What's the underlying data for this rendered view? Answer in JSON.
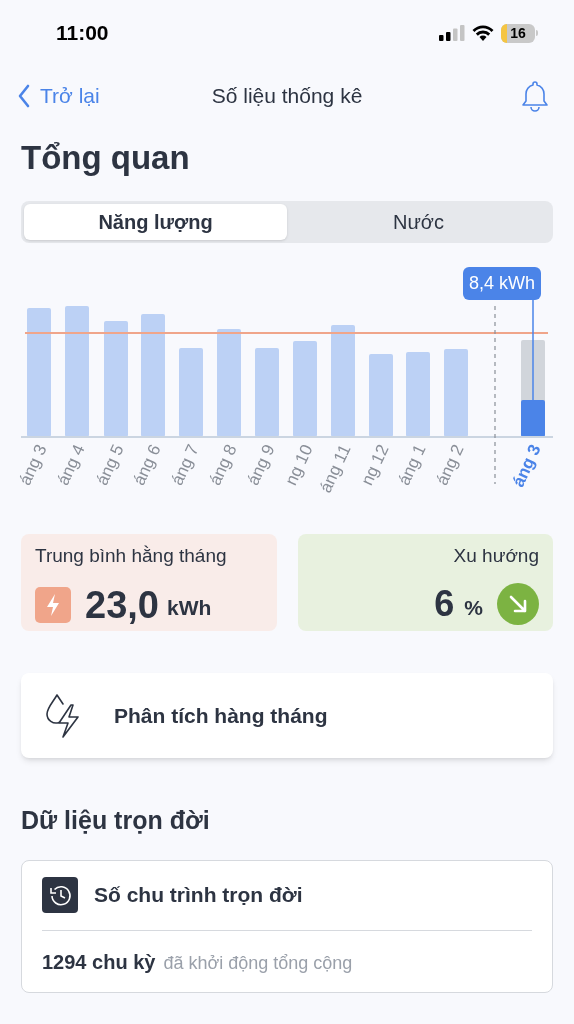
{
  "status_bar": {
    "time": "11:00",
    "battery": "16"
  },
  "nav": {
    "back": "Trở lại",
    "title": "Số liệu thống kê"
  },
  "heading": "Tổng quan",
  "tabs": [
    {
      "label": "Năng lượng",
      "selected": true
    },
    {
      "label": "Nước",
      "selected": false
    }
  ],
  "chart": {
    "tooltip": "8,4 kWh",
    "months": [
      {
        "label": "áng 3",
        "selected": false
      },
      {
        "label": "áng 4",
        "selected": false
      },
      {
        "label": "áng 5",
        "selected": false
      },
      {
        "label": "áng 6",
        "selected": false
      },
      {
        "label": "áng 7",
        "selected": false
      },
      {
        "label": "áng 8",
        "selected": false
      },
      {
        "label": "áng 9",
        "selected": false
      },
      {
        "label": "ng 10",
        "selected": false
      },
      {
        "label": "áng 11",
        "selected": false
      },
      {
        "label": "ng 12",
        "selected": false
      },
      {
        "label": "áng 1",
        "selected": false
      },
      {
        "label": "áng 2",
        "selected": false
      },
      {
        "label": "áng 3",
        "selected": true
      }
    ]
  },
  "average": {
    "label": "Trung bình hằng tháng",
    "value": "23,0",
    "unit": "kWh"
  },
  "trend": {
    "label": "Xu hướng",
    "value": "6",
    "unit": "%"
  },
  "analysis": {
    "label": "Phân tích hàng tháng"
  },
  "lifetime": {
    "heading": "Dữ liệu trọn đời",
    "title": "Số chu trình trọn đời",
    "count": "1294 chu kỳ",
    "note": "đã khởi động tổng cộng"
  }
}
